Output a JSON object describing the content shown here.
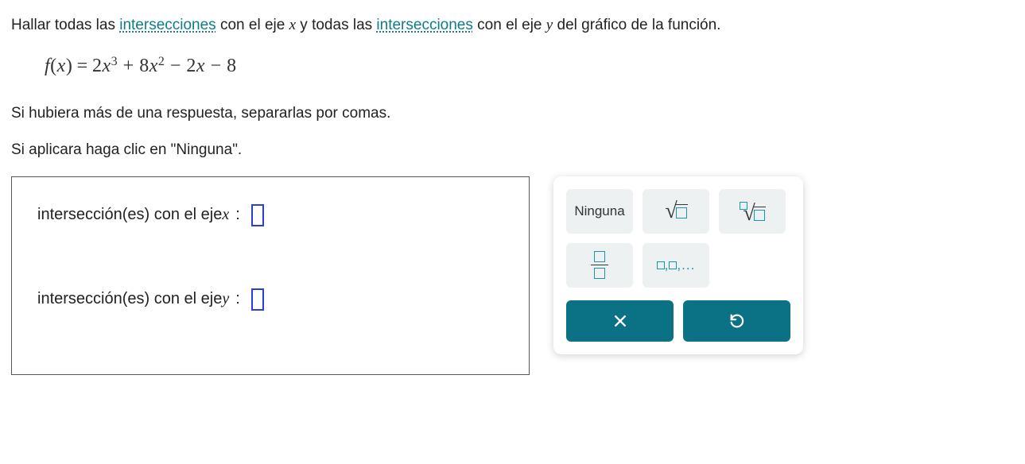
{
  "question": {
    "sentence1_pre": "Hallar todas las ",
    "link1": "intersecciones",
    "sentence1_mid1": " con el eje ",
    "axis_x": "x",
    "sentence1_mid2": " y todas las ",
    "link2": "intersecciones",
    "sentence1_mid3": " con el eje ",
    "axis_y": "y",
    "sentence1_end": " del gráfico de la función.",
    "formula": {
      "lhs_f": "f",
      "lhs_open": "(",
      "lhs_x": "x",
      "lhs_close": ")",
      "eq": "=",
      "t1_coef": "2",
      "t1_var": "x",
      "t1_exp": "3",
      "plus1": " + ",
      "t2_coef": "8",
      "t2_var": "x",
      "t2_exp": "2",
      "minus1": " − ",
      "t3_coef": "2",
      "t3_var": "x",
      "minus2": " − ",
      "t4": "8"
    },
    "note1": "Si hubiera más de una respuesta, separarlas por comas.",
    "note2": "Si aplicara haga clic en \"Ninguna\"."
  },
  "answers": {
    "x_label_pre": "intersección(es) con el eje ",
    "x_var": "x",
    "y_label_pre": "intersección(es) con el eje ",
    "y_var": "y",
    "colon": ":"
  },
  "keypad": {
    "ninguna": "Ninguna",
    "list_placeholder": "▢,▢,..."
  }
}
